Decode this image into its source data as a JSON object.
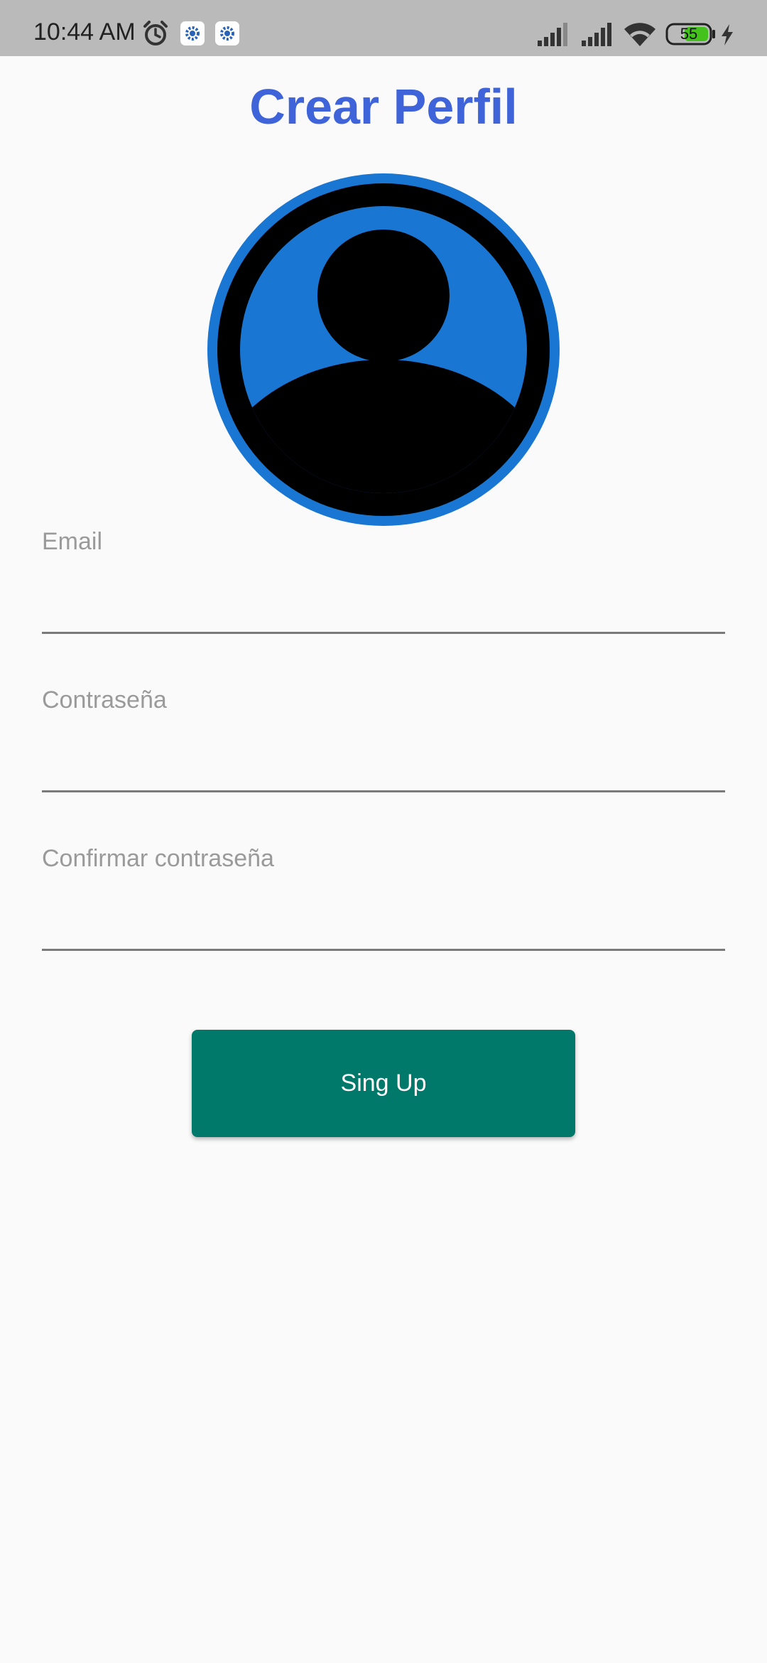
{
  "status_bar": {
    "time": "10:44 AM",
    "battery_level": "55",
    "icons": [
      "alarm-icon",
      "app-gear-icon",
      "app-gear-icon",
      "signal-icon",
      "signal-icon",
      "wifi-icon",
      "battery-icon",
      "charging-icon"
    ],
    "background_color": "#bababa"
  },
  "page": {
    "title": "Crear Perfil",
    "title_color": "#3f63d8",
    "background_color": "#fafafa"
  },
  "avatar": {
    "icon": "account-circle-icon",
    "ring_color": "#1976d2",
    "fill_color": "#1976d2",
    "figure_color": "#000000"
  },
  "form": {
    "email_label": "Email",
    "email_value": "",
    "password_label": "Contraseña",
    "password_value": "",
    "confirm_label": "Confirmar contraseña",
    "confirm_value": ""
  },
  "signup_button": {
    "label": "Sing Up",
    "color": "#00796b"
  }
}
